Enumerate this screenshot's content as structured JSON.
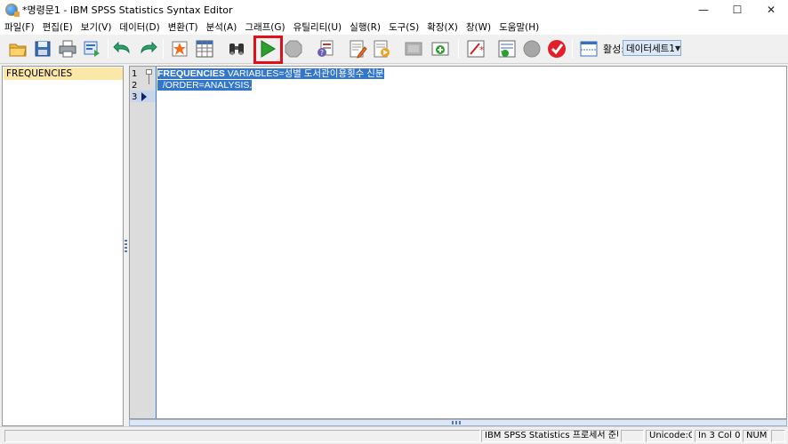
{
  "window": {
    "title": "*명령문1 - IBM SPSS Statistics Syntax Editor",
    "minimize": "—",
    "maximize": "☐",
    "close": "✕"
  },
  "menu": [
    "파일(F)",
    "편집(E)",
    "보기(V)",
    "데이터(D)",
    "변환(T)",
    "분석(A)",
    "그래프(G)",
    "유틸리티(U)",
    "실행(R)",
    "도구(S)",
    "확장(X)",
    "창(W)",
    "도움말(H)"
  ],
  "toolbar": {
    "active_label": "활성:",
    "dataset": "데이터세트1"
  },
  "navigator": {
    "items": [
      "FREQUENCIES"
    ]
  },
  "editor": {
    "line_numbers": [
      "1",
      "2",
      "3"
    ],
    "lines": [
      {
        "keyword": "FREQUENCIES",
        "rest": " VARIABLES=성별 도서관이용횟수 신분"
      },
      {
        "keyword": "",
        "rest": "  /ORDER=ANALYSIS."
      }
    ]
  },
  "status": {
    "processor": "IBM SPSS Statistics 프로세서 준비 완료",
    "unicode": "Unicode:ON",
    "position": "In 3 Col 0",
    "num": "NUM"
  },
  "colors": {
    "selection": "#3377cc",
    "nav_highlight": "#fbe7a8",
    "run_highlight": "#e0101a"
  }
}
